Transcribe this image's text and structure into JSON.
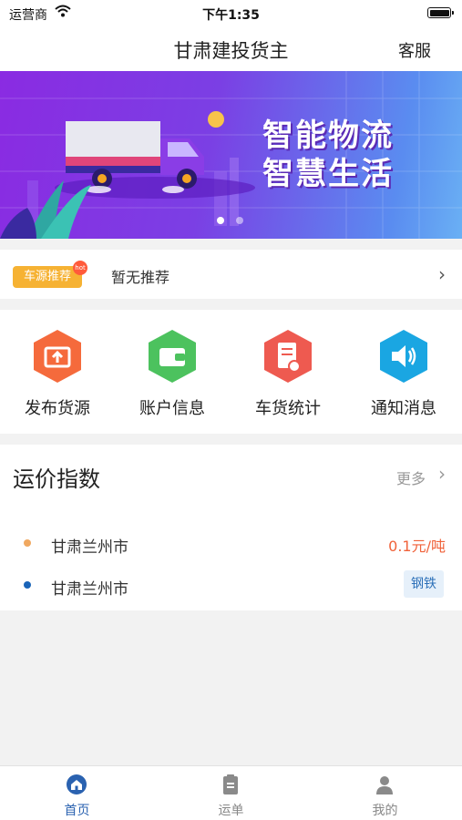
{
  "status_bar": {
    "carrier": "运营商",
    "time": "下午1:35"
  },
  "nav": {
    "title": "甘肃建投货主",
    "service": "客服"
  },
  "banner": {
    "line1": "智能物流",
    "line2": "智慧生活",
    "active_dot": 1,
    "dot_count": 2
  },
  "recommend": {
    "badge": "车源推荐",
    "hot": "hot",
    "text": "暂无推荐"
  },
  "quick_actions": [
    {
      "label": "发布货源",
      "icon": "publish-box-icon",
      "color": "#f56a3c"
    },
    {
      "label": "账户信息",
      "icon": "wallet-icon",
      "color": "#4cc25e"
    },
    {
      "label": "车货统计",
      "icon": "statement-icon",
      "color": "#ee5a50"
    },
    {
      "label": "通知消息",
      "icon": "speaker-icon",
      "color": "#1aa6e2"
    }
  ],
  "freight_index": {
    "title": "运价指数",
    "more": "更多",
    "rows": [
      {
        "city": "甘肃兰州市",
        "value": "0.1元/吨",
        "bullet_color": "#f0a860"
      },
      {
        "city": "甘肃兰州市",
        "tag": "钢铁",
        "bullet_color": "#1a64b8"
      }
    ]
  },
  "tabs": [
    {
      "label": "首页",
      "icon": "home-icon",
      "active": true
    },
    {
      "label": "运单",
      "icon": "clipboard-icon",
      "active": false
    },
    {
      "label": "我的",
      "icon": "user-icon",
      "active": false
    }
  ],
  "colors": {
    "active_tab": "#2a62b0",
    "inactive_tab": "#888888",
    "accent_price": "#f0623a"
  }
}
